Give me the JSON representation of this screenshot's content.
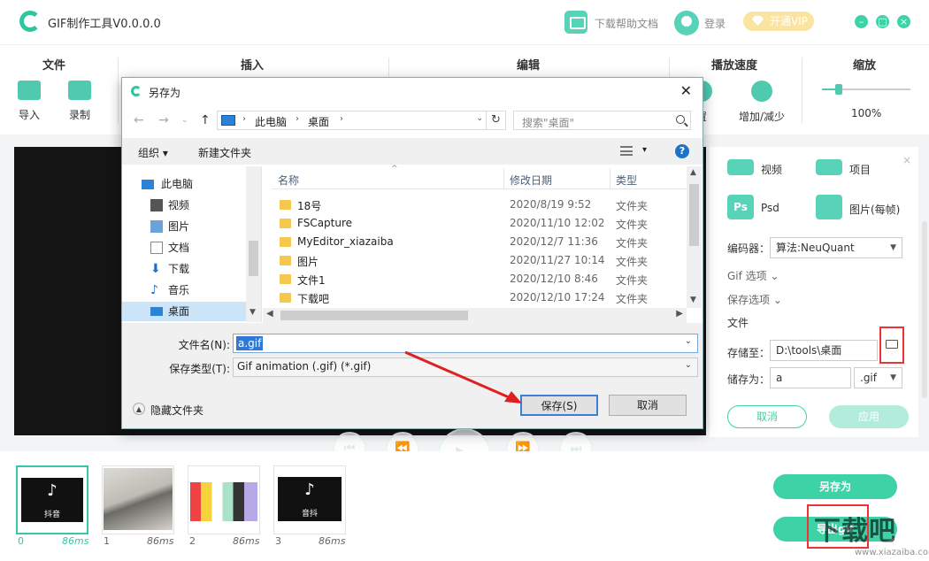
{
  "app": {
    "title": "GIF制作工具V0.0.0.0",
    "download_help": "下载帮助文档",
    "login": "登录",
    "vip": "开通VIP",
    "accent_color": "#3ed2a7"
  },
  "toolbar": {
    "groups": [
      "文件",
      "插入",
      "编辑",
      "播放速度",
      "缩放"
    ],
    "import": "导入",
    "record": "录制",
    "settings_partial": "置",
    "speed_adjust": "增加/减少",
    "zoom_value": "100%",
    "zoom_level": 0.15
  },
  "right_panel": {
    "formats": [
      "视频",
      "项目",
      "Psd",
      "图片(每帧)"
    ],
    "psd_icon_text": "Ps",
    "encoder_label": "编码器：",
    "encoder_value": "算法:NeuQuant",
    "gif_options": "Gif 选项",
    "save_options": "保存选项",
    "file_label": "文件",
    "save_to_label": "存储至：",
    "save_to_value": "D:\\tools\\桌面",
    "save_as_label": "储存为：",
    "save_as_name": "a",
    "save_as_ext": ".gif",
    "cancel": "取消",
    "apply": "应用"
  },
  "frames": [
    {
      "index": "0",
      "ms": "86ms",
      "caption": "抖音"
    },
    {
      "index": "1",
      "ms": "86ms",
      "caption": ""
    },
    {
      "index": "2",
      "ms": "86ms",
      "caption": ""
    },
    {
      "index": "3",
      "ms": "86ms",
      "caption": "音抖"
    }
  ],
  "actions": {
    "save_as": "另存为",
    "export_gif": "导出gif"
  },
  "watermark": {
    "text": "下载吧",
    "url": "www.xiazaiba.com"
  },
  "dialog": {
    "title": "另存为",
    "breadcrumb": [
      "此电脑",
      "桌面"
    ],
    "search_placeholder": "搜索\"桌面\"",
    "organize": "组织",
    "new_folder": "新建文件夹",
    "tree": [
      "此电脑",
      "视频",
      "图片",
      "文档",
      "下载",
      "音乐",
      "桌面"
    ],
    "columns": [
      "名称",
      "修改日期",
      "类型"
    ],
    "files": [
      {
        "name": "18号",
        "date": "2020/8/19 9:52",
        "type": "文件夹"
      },
      {
        "name": "FSCapture",
        "date": "2020/11/10 12:02",
        "type": "文件夹"
      },
      {
        "name": "MyEditor_xiazaiba",
        "date": "2020/12/7 11:36",
        "type": "文件夹"
      },
      {
        "name": "图片",
        "date": "2020/11/27 10:14",
        "type": "文件夹"
      },
      {
        "name": "文件1",
        "date": "2020/12/10 8:46",
        "type": "文件夹"
      },
      {
        "name": "下载吧",
        "date": "2020/12/10 17:24",
        "type": "文件夹"
      }
    ],
    "filename_label": "文件名(N):",
    "filename_value": "a.gif",
    "filetype_label": "保存类型(T):",
    "filetype_value": "Gif animation (.gif) (*.gif)",
    "hide_folders": "隐藏文件夹",
    "save_button": "保存(S)",
    "cancel_button": "取消"
  }
}
